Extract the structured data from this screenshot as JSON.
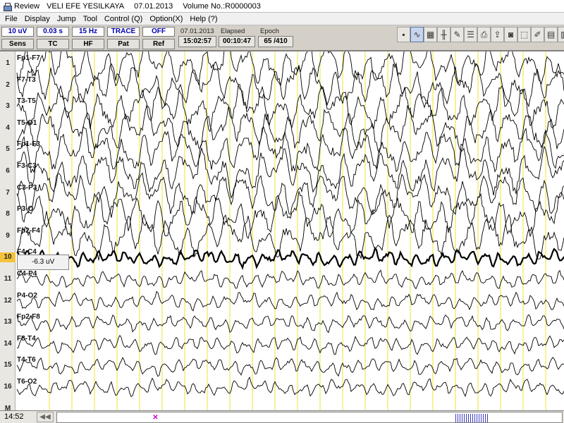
{
  "titlebar": {
    "app": "Review",
    "patient": "VELI EFE YESILKAYA",
    "date": "07.01.2013",
    "volume": "Volume No.:R0000003"
  },
  "menu": [
    "File",
    "Display",
    "Jump",
    "Tool",
    "Control (Q)",
    "Option(X)",
    "Help (?)"
  ],
  "params": [
    {
      "value": "10 uV",
      "label": "Sens"
    },
    {
      "value": "0.03 s",
      "label": "TC"
    },
    {
      "value": "15 Hz",
      "label": "HF"
    },
    {
      "value": "TRACE",
      "label": "Pat"
    },
    {
      "value": "OFF",
      "label": "Ref"
    }
  ],
  "info": {
    "date_label": "07.01.2013",
    "clock": "15:02:57",
    "elapsed_label": "Elapsed",
    "elapsed": "00:10:47",
    "epoch_label": "Epoch",
    "epoch": "65 /410"
  },
  "tool_icons": [
    "save-icon",
    "waveform-icon",
    "grid-icon",
    "montage-icon",
    "pen-icon",
    "list-icon",
    "print-icon",
    "export-icon",
    "camera-icon",
    "select-icon",
    "edit-icon",
    "grid-view-icon",
    "report-icon",
    "power-icon"
  ],
  "channels": [
    {
      "num": "1",
      "label": "Fp1-F7"
    },
    {
      "num": "2",
      "label": "F7-T3"
    },
    {
      "num": "3",
      "label": "T3-T5"
    },
    {
      "num": "4",
      "label": "T5-O1"
    },
    {
      "num": "5",
      "label": "Fp1-F3"
    },
    {
      "num": "6",
      "label": "F3-C3"
    },
    {
      "num": "7",
      "label": "C3-P3"
    },
    {
      "num": "8",
      "label": "P3-O"
    },
    {
      "num": "9",
      "label": "Fp2-F4"
    },
    {
      "num": "10",
      "label": "F4-C4"
    },
    {
      "num": "11",
      "label": "C4-P4"
    },
    {
      "num": "12",
      "label": "P4-O2"
    },
    {
      "num": "13",
      "label": "Fp2-F8"
    },
    {
      "num": "14",
      "label": "F8-T4"
    },
    {
      "num": "15",
      "label": "T4-T6"
    },
    {
      "num": "16",
      "label": "T6-O2"
    },
    {
      "num": "M",
      "label": ""
    }
  ],
  "selected_channel": "10",
  "tooltip": "-6.3 uV",
  "bottom": {
    "time": "14:52",
    "prev_label": "◀◀",
    "marker": "✕"
  },
  "colors": {
    "grid_line": "#e6e000",
    "trace": "#000000",
    "selected_row": "#f4c23c",
    "marker": "#d000d0",
    "param_value": "#0000aa"
  }
}
